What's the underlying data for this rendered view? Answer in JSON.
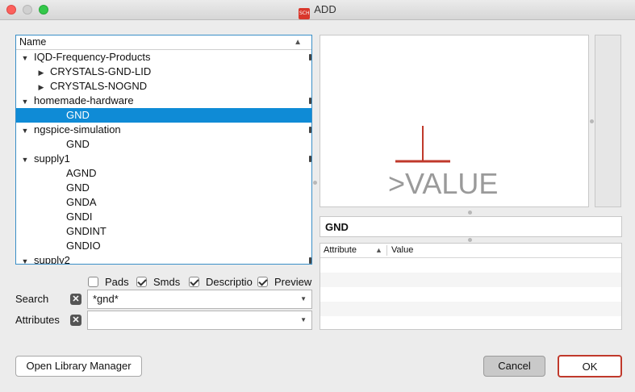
{
  "window": {
    "title": "ADD",
    "app_icon_text": "SCH"
  },
  "tree": {
    "column_header": "Name",
    "rows": [
      {
        "label": "IQD-Frequency-Products",
        "level": 0,
        "toggle": "▼"
      },
      {
        "label": "CRYSTALS-GND-LID",
        "level": 1,
        "toggle": "▶"
      },
      {
        "label": "CRYSTALS-NOGND",
        "level": 1,
        "toggle": "▶"
      },
      {
        "label": "homemade-hardware",
        "level": 0,
        "toggle": "▼"
      },
      {
        "label": "GND",
        "level": 2,
        "toggle": "",
        "selected": true
      },
      {
        "label": "ngspice-simulation",
        "level": 0,
        "toggle": "▼"
      },
      {
        "label": "GND",
        "level": 2,
        "toggle": ""
      },
      {
        "label": "supply1",
        "level": 0,
        "toggle": "▼"
      },
      {
        "label": "AGND",
        "level": 2,
        "toggle": ""
      },
      {
        "label": "GND",
        "level": 2,
        "toggle": ""
      },
      {
        "label": "GNDA",
        "level": 2,
        "toggle": ""
      },
      {
        "label": "GNDI",
        "level": 2,
        "toggle": ""
      },
      {
        "label": "GNDINT",
        "level": 2,
        "toggle": ""
      },
      {
        "label": "GNDIO",
        "level": 2,
        "toggle": ""
      },
      {
        "label": "supply2",
        "level": 0,
        "toggle": "▼"
      }
    ]
  },
  "preview": {
    "symbol_text": ">VALUE",
    "symbol_color": "#c0392b",
    "text_color": "#9a9a9a"
  },
  "selected_name": "GND",
  "attributes": {
    "col_attribute": "Attribute",
    "col_value": "Value"
  },
  "options": {
    "pads": {
      "label": "Pads",
      "checked": false
    },
    "smds": {
      "label": "Smds",
      "checked": true
    },
    "description": {
      "label": "Descriptio",
      "checked": true
    },
    "preview": {
      "label": "Preview",
      "checked": true
    }
  },
  "search": {
    "label": "Search",
    "value": "*gnd*"
  },
  "attributes_filter": {
    "label": "Attributes",
    "value": ""
  },
  "buttons": {
    "open_library_manager": "Open Library Manager",
    "cancel": "Cancel",
    "ok": "OK"
  }
}
